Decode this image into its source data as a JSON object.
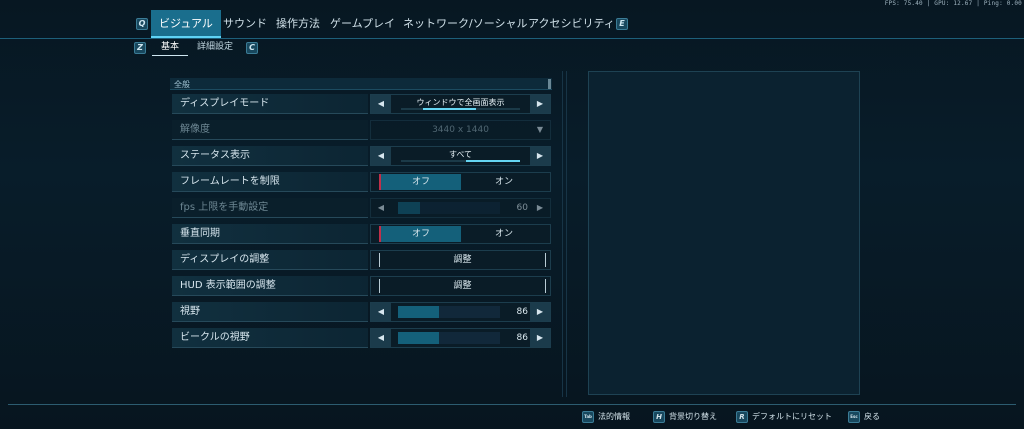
{
  "perf_readout": "FPS: 75.40 | GPU: 12.67 | Ping: 0.00",
  "top_tabs": {
    "left_key": "Q",
    "right_key": "E",
    "items": [
      "ビジュアル",
      "サウンド",
      "操作方法",
      "ゲームプレイ",
      "ネットワーク/ソーシャル",
      "アクセシビリティ"
    ],
    "active_index": 0
  },
  "sub_tabs": {
    "left_key": "Z",
    "right_key": "C",
    "items": [
      "基本",
      "詳細設定"
    ],
    "active_index": 0
  },
  "section": {
    "title": "全般"
  },
  "settings": {
    "display_mode": {
      "label": "ディスプレイモード",
      "value": "ウィンドウで全画面表示",
      "progress": 0.33
    },
    "resolution": {
      "label": "解像度",
      "value": "3440 x 1440"
    },
    "status_display": {
      "label": "ステータス表示",
      "value": "すべて",
      "progress": 1.0
    },
    "frame_limit": {
      "label": "フレームレートを制限",
      "off": "オフ",
      "on": "オン",
      "selected": "オフ"
    },
    "fps_cap": {
      "label": "fps 上限を手動設定",
      "value": "60",
      "fraction": 0.22
    },
    "vsync": {
      "label": "垂直同期",
      "off": "オフ",
      "on": "オン",
      "selected": "オフ"
    },
    "display_adjust": {
      "label": "ディスプレイの調整",
      "button": "調整"
    },
    "hud_adjust": {
      "label": "HUD 表示範囲の調整",
      "button": "調整"
    },
    "fov": {
      "label": "視野",
      "value": "86",
      "fraction": 0.4
    },
    "vehicle_fov": {
      "label": "ビークルの視野",
      "value": "86",
      "fraction": 0.4
    }
  },
  "footer": {
    "items": [
      {
        "key": "Tab",
        "label": "法的情報"
      },
      {
        "key": "H",
        "label": "背景切り替え"
      },
      {
        "key": "R",
        "label": "デフォルトにリセット"
      },
      {
        "key": "Esc",
        "label": "戻る"
      }
    ]
  },
  "colors": {
    "accent": "#5fd3f5",
    "active_tab": "#1a6e8d",
    "toggle_marker": "#c0304a"
  }
}
